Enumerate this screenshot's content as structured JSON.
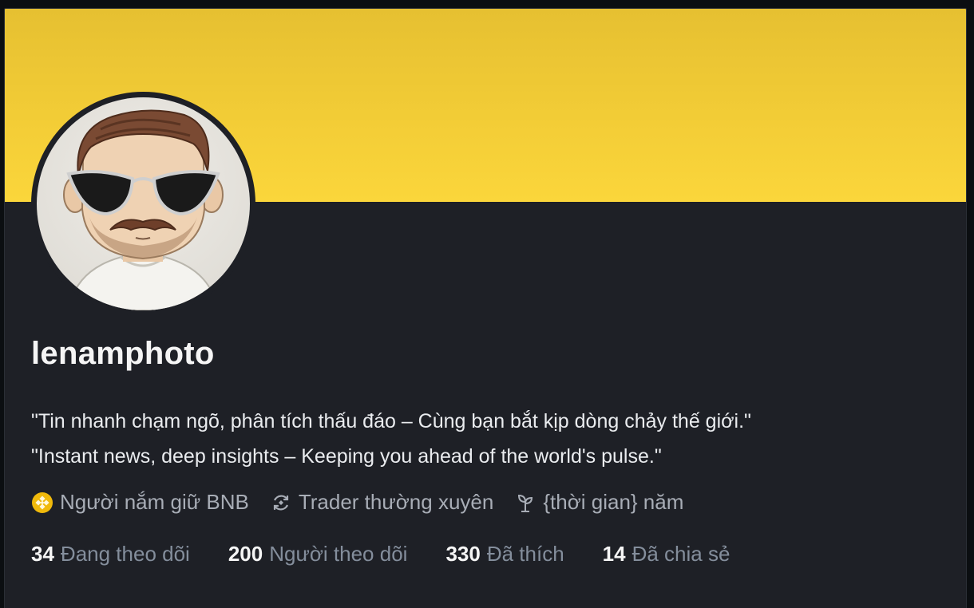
{
  "profile": {
    "username": "lenamphoto",
    "bio_line1": "\"Tin nhanh chạm ngõ, phân tích thấu đáo – Cùng bạn bắt kịp dòng chảy thế giới.\"",
    "bio_line2": "\"Instant news, deep insights – Keeping you ahead of the world's pulse.\""
  },
  "tags": [
    {
      "icon": "bnb-coin-icon",
      "label": "Người nắm giữ BNB"
    },
    {
      "icon": "trade-cycle-icon",
      "label": "Trader thường xuyên"
    },
    {
      "icon": "sprout-icon",
      "label": "{thời gian} năm"
    }
  ],
  "stats": [
    {
      "value": "34",
      "label": "Đang theo dõi"
    },
    {
      "value": "200",
      "label": "Người theo dõi"
    },
    {
      "value": "330",
      "label": "Đã thích"
    },
    {
      "value": "14",
      "label": "Đã chia sẻ"
    }
  ],
  "colors": {
    "banner": "#f2cc36",
    "card_bg": "#1e2026",
    "page_bg": "#0b0e11",
    "muted_text": "#848e9c",
    "bnb_gold": "#f0b90b"
  }
}
